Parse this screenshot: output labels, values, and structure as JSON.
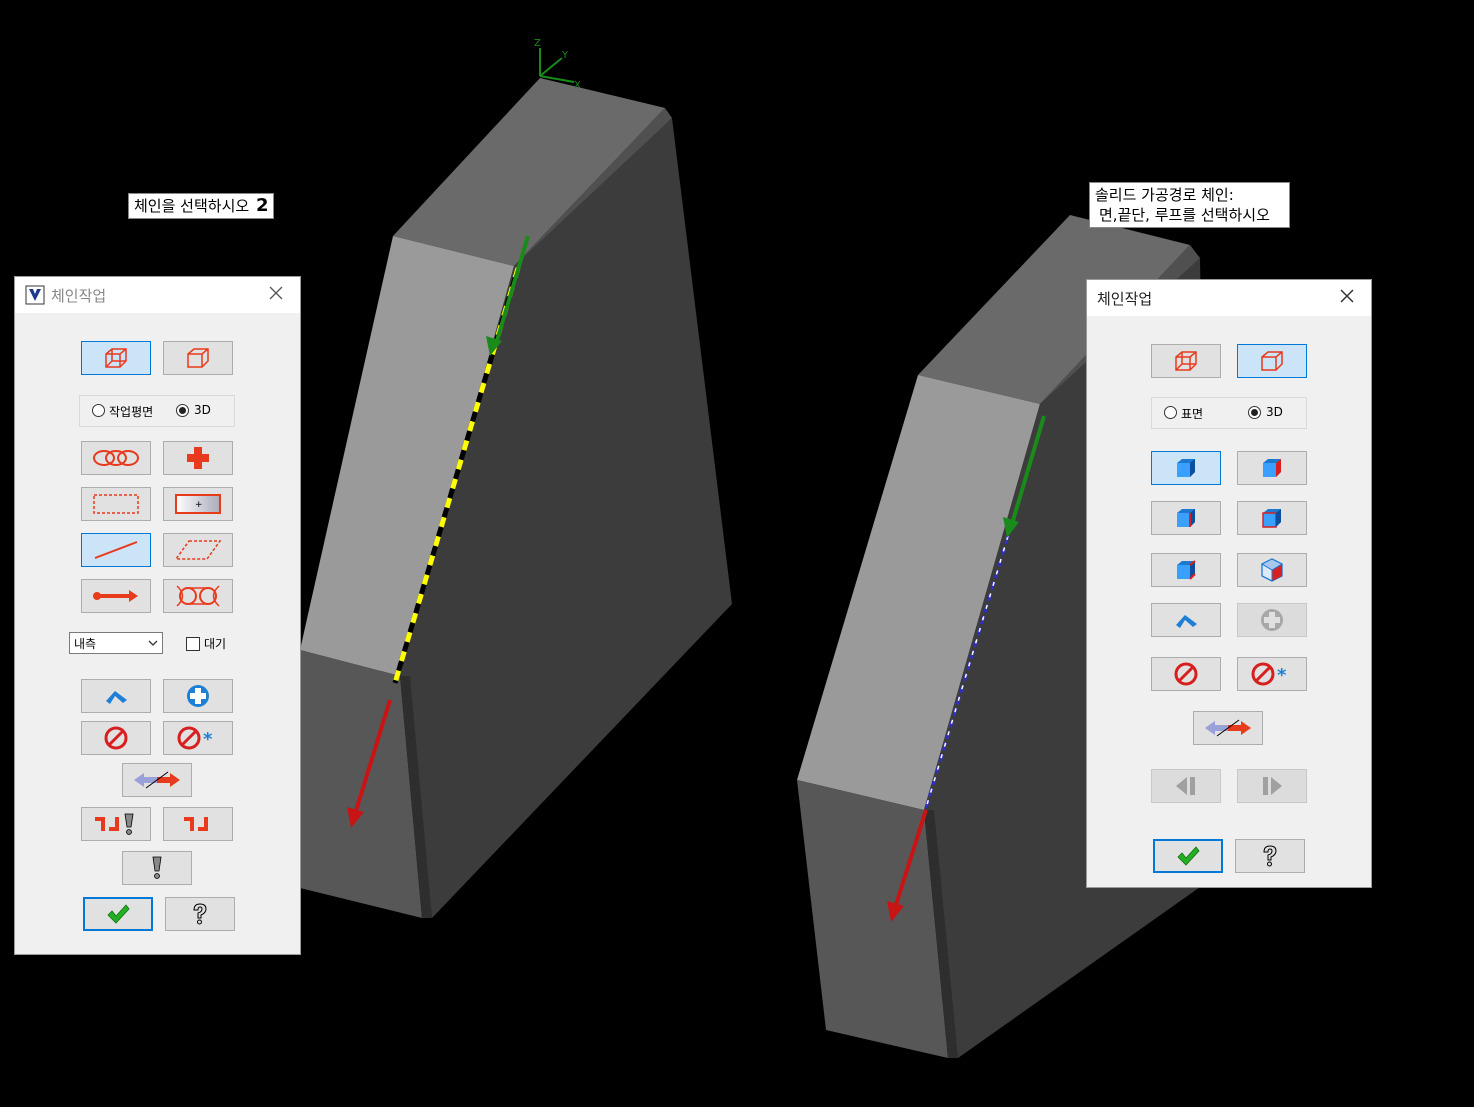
{
  "prompts": {
    "left": "체인을 선택하시오",
    "left_number": "2",
    "right_line1": "솔리드 가공경로 체인:",
    "right_line2": "면,끝단, 루프를 선택하시오"
  },
  "axis_labels": {
    "z": "Z",
    "y": "Y",
    "x": "X"
  },
  "left_dialog": {
    "title": "체인작업",
    "close_icon": "close-icon",
    "mode_buttons": [
      {
        "icon": "wireframe-cube-icon",
        "active": true
      },
      {
        "icon": "solid-cube-icon",
        "active": false
      }
    ],
    "radio_options": [
      {
        "label": "작업평면",
        "selected": false
      },
      {
        "label": "3D",
        "selected": true
      }
    ],
    "tool_buttons": [
      {
        "icon": "chain-icon",
        "active": false
      },
      {
        "icon": "point-cross-icon",
        "active": false
      },
      {
        "icon": "window-icon",
        "active": false
      },
      {
        "icon": "area-icon",
        "active": false
      },
      {
        "icon": "single-line-icon",
        "active": true
      },
      {
        "icon": "polygon-icon",
        "active": false
      },
      {
        "icon": "vector-icon",
        "active": false
      },
      {
        "icon": "partial-chain-icon",
        "active": false
      }
    ],
    "inside_select": "내측",
    "wait_label": "대기",
    "wait_checked": false,
    "action_buttons": [
      {
        "icon": "unselect-last-icon"
      },
      {
        "icon": "add-icon"
      },
      {
        "icon": "clear-icon"
      },
      {
        "icon": "clear-all-icon"
      }
    ],
    "reverse_icon": "reverse-direction-icon",
    "option_buttons": [
      {
        "icon": "chain-options-warning-icon"
      },
      {
        "icon": "chain-options-icon"
      }
    ],
    "warning_icon": "exclamation-icon",
    "ok_icon": "checkmark-icon",
    "help_icon": "help-icon"
  },
  "right_dialog": {
    "title": "체인작업",
    "close_icon": "close-icon",
    "mode_buttons": [
      {
        "icon": "wireframe-cube-icon",
        "active": false
      },
      {
        "icon": "solid-cube-icon",
        "active": true
      }
    ],
    "radio_options": [
      {
        "label": "표면",
        "selected": false
      },
      {
        "label": "3D",
        "selected": true
      }
    ],
    "selection_buttons": [
      {
        "icon": "body-select-icon",
        "active": true
      },
      {
        "icon": "face-select-icon",
        "active": false
      },
      {
        "icon": "edge-select-icon",
        "active": false
      },
      {
        "icon": "loop-select-icon",
        "active": false
      },
      {
        "icon": "partial-loop-icon",
        "active": false
      },
      {
        "icon": "back-face-icon",
        "active": false
      }
    ],
    "action_buttons": [
      {
        "icon": "unselect-last-icon",
        "enabled": true
      },
      {
        "icon": "add-icon",
        "enabled": false
      },
      {
        "icon": "clear-icon",
        "enabled": true
      },
      {
        "icon": "clear-all-icon",
        "enabled": true
      }
    ],
    "reverse_icon": "reverse-direction-icon",
    "nav_buttons": [
      {
        "icon": "previous-icon",
        "enabled": false
      },
      {
        "icon": "next-icon",
        "enabled": false
      }
    ],
    "ok_icon": "checkmark-icon",
    "help_icon": "help-icon"
  },
  "colors": {
    "background": "#000000",
    "chain_highlight": "#ffff00",
    "start_arrow": "#1a8a1a",
    "end_arrow": "#c81414",
    "accent": "#0078d7"
  }
}
